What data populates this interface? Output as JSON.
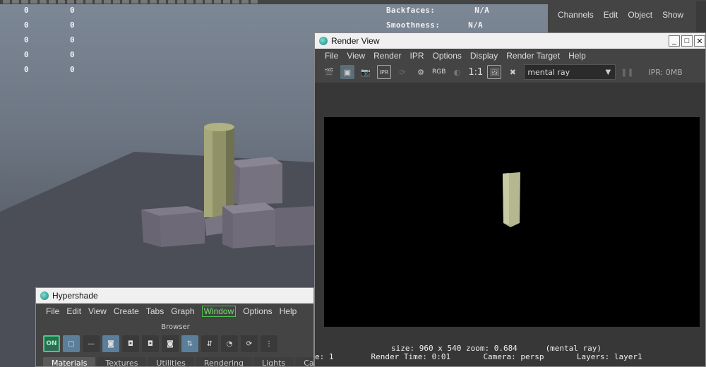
{
  "viewport": {
    "hud_numbers": [
      [
        "0",
        "0"
      ],
      [
        "0",
        "0"
      ],
      [
        "0",
        "0"
      ],
      [
        "0",
        "0"
      ],
      [
        "0",
        "0"
      ]
    ],
    "hud_right": [
      {
        "label": "Backfaces:",
        "value": "N/A"
      },
      {
        "label": "Smoothness:",
        "value": "N/A"
      }
    ]
  },
  "channel_box": {
    "menu": [
      "Channels",
      "Edit",
      "Object",
      "Show"
    ]
  },
  "render_view": {
    "title": "Render View",
    "menu": [
      "File",
      "View",
      "Render",
      "IPR",
      "Options",
      "Display",
      "Render Target",
      "Help"
    ],
    "toolbar": {
      "rgb_label": "RGB",
      "ratio_label": "1:1",
      "renderer_selected": "mental ray",
      "ipr_memory": "IPR: 0MB"
    },
    "info_line1": "size: 960 x 540 zoom: 0.684",
    "info_renderer": "(mental ray)",
    "info_frame": "e: 1",
    "info_render_time": "Render Time: 0:01",
    "info_camera": "Camera: persp",
    "info_layers": "Layers: layer1"
  },
  "hypershade": {
    "title": "Hypershade",
    "menu": [
      "File",
      "Edit",
      "View",
      "Create",
      "Tabs",
      "Graph",
      "Window",
      "Options",
      "Help"
    ],
    "browser_label": "Browser",
    "on_label": "ON",
    "tabs": [
      "Materials",
      "Textures",
      "Utilities",
      "Rendering",
      "Lights",
      "Cameras"
    ]
  },
  "colors": {
    "viewport_bg": "#6d7683",
    "panel_bg": "#444444",
    "render_canvas": "#000000",
    "accent_green": "#4fc04f",
    "cylinder": "#8f9167"
  }
}
